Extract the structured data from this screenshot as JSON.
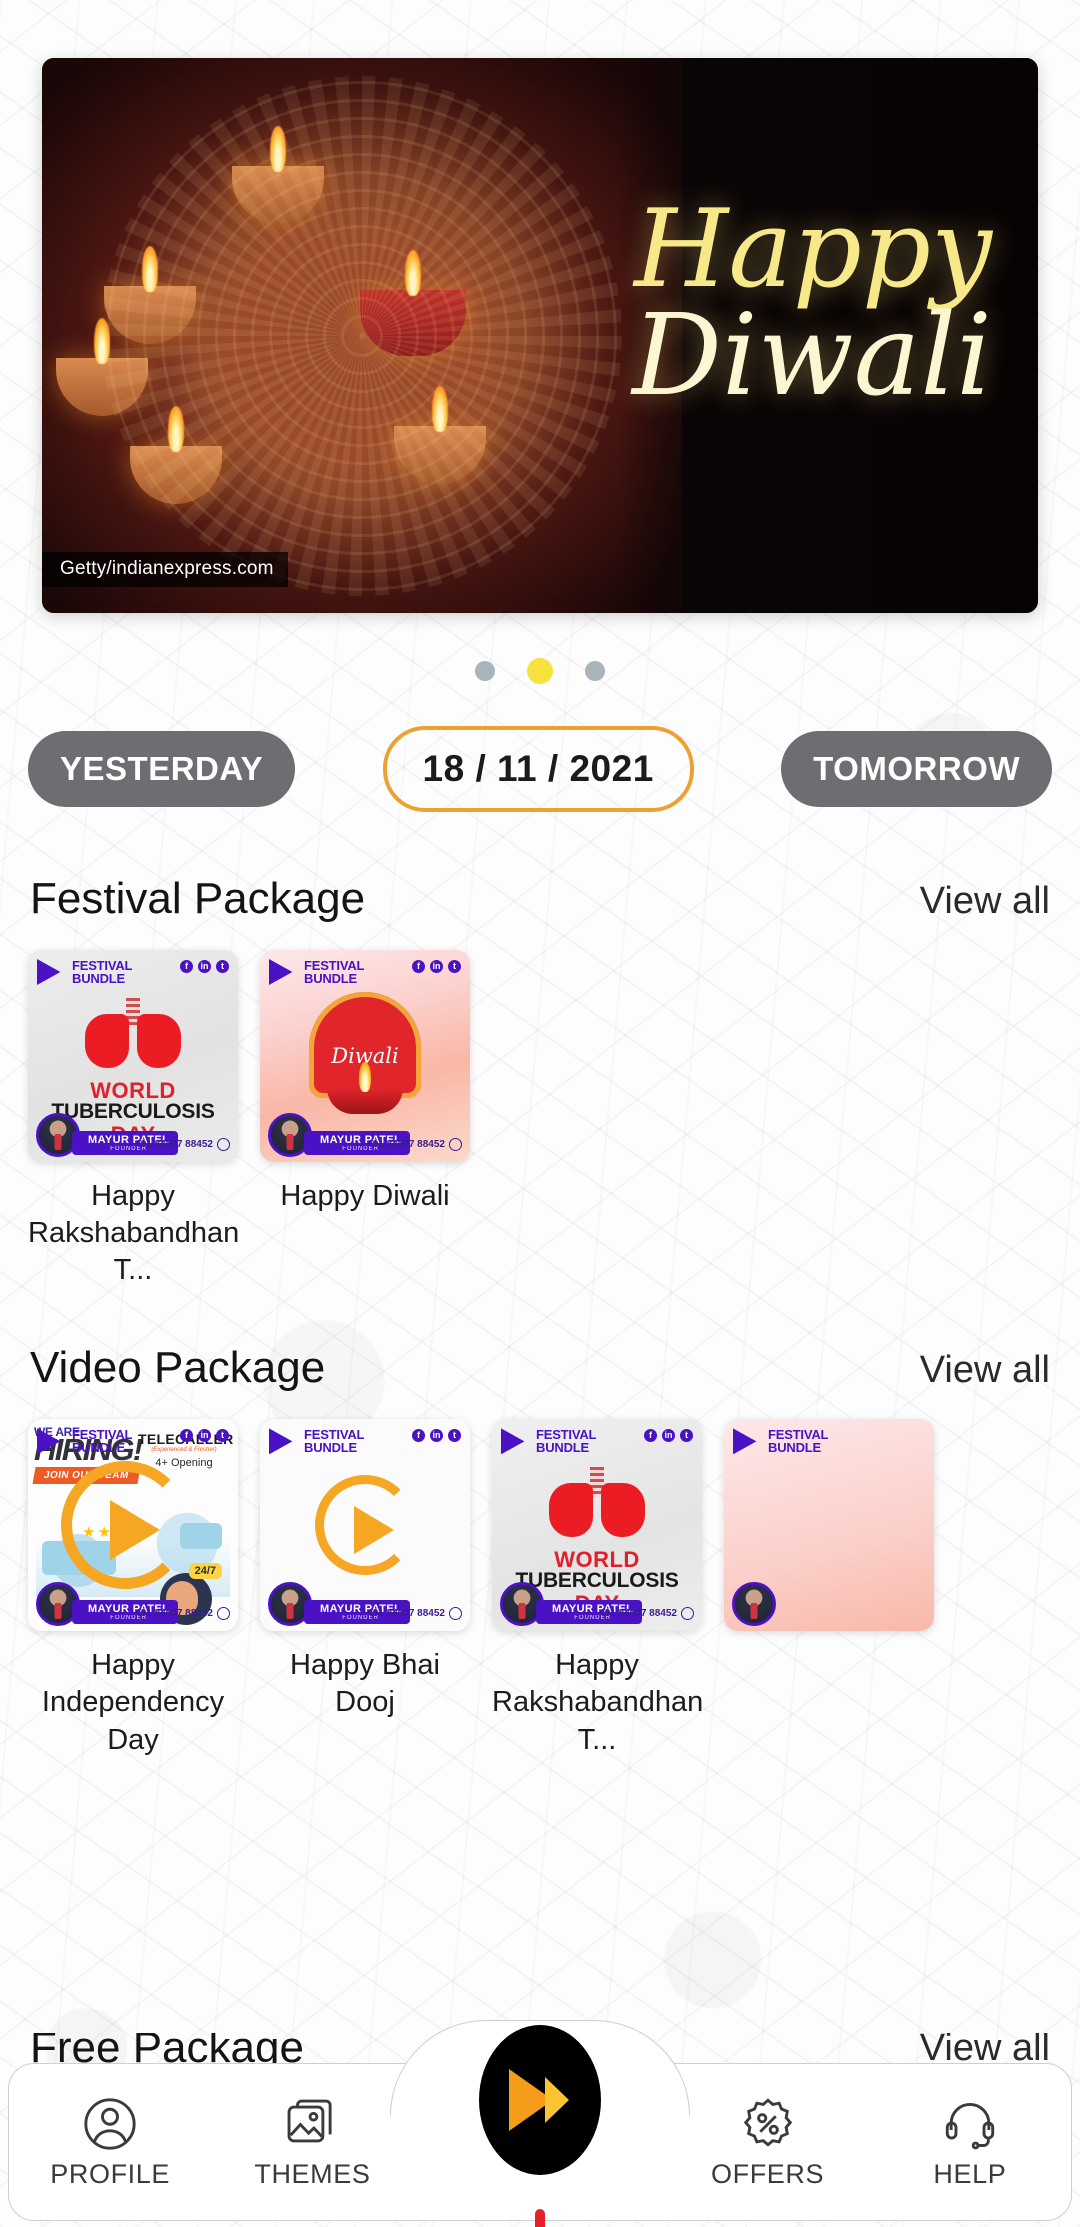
{
  "banner": {
    "title_line1": "Happy",
    "title_line2": "Diwali",
    "credit": "Getty/indianexpress.com"
  },
  "carousel": {
    "dots": [
      "inactive",
      "active",
      "inactive"
    ],
    "active_color": "#f7e23f",
    "inactive_color": "#a7b4bb"
  },
  "date_selector": {
    "yesterday_label": "YESTERDAY",
    "current_date": "18 / 11 / 2021",
    "tomorrow_label": "TOMORROW",
    "accent_color": "#eda033"
  },
  "sections": [
    {
      "title": "Festival Package",
      "view_all": "View all"
    },
    {
      "title": "Video Package",
      "view_all": "View all"
    },
    {
      "title": "Free Package",
      "view_all": "View all"
    }
  ],
  "card_chrome": {
    "brand_line1": "FESTIVAL",
    "brand_line2": "BUNDLE",
    "socials": [
      "f",
      "in",
      "t"
    ],
    "owner_name": "MAYUR PATEL",
    "owner_role": "FOUNDER",
    "phone": "+91 84607 88452"
  },
  "festival_package": {
    "cards": [
      {
        "caption": "Happy Rakshabandhan T...",
        "art": "world-tuberculosis-day",
        "art_text": {
          "line1": "WORLD",
          "line2": "TUBERCULOSIS",
          "line3": "DAY"
        }
      },
      {
        "caption": "Happy Diwali",
        "art": "diwali-arch",
        "art_text": {
          "line1": "Diwali"
        }
      }
    ]
  },
  "video_package": {
    "cards": [
      {
        "caption": "Happy Independency Day",
        "art": "we-are-hiring",
        "art_text": {
          "we": "WE ARE",
          "big": "HIRING!",
          "join": "JOIN OUR TEAM",
          "role": "TELECALLER",
          "role_sub": "(Experienced & Fresher)",
          "openings": "4+ Opening",
          "badge": "24/7"
        }
      },
      {
        "caption": "Happy Bhai Dooj",
        "art": "plain-play"
      },
      {
        "caption": "Happy Rakshabandhan T...",
        "art": "world-tuberculosis-day",
        "art_text": {
          "line1": "WORLD",
          "line2": "TUBERCULOSIS",
          "line3": "DAY"
        }
      },
      {
        "caption": "",
        "art": "pink-fade"
      }
    ]
  },
  "bottom_nav": {
    "items": [
      {
        "label": "PROFILE",
        "icon": "person-icon"
      },
      {
        "label": "THEMES",
        "icon": "image-gallery-icon"
      },
      {
        "label": "OFFERS",
        "icon": "percent-badge-icon"
      },
      {
        "label": "HELP",
        "icon": "headset-icon"
      }
    ],
    "fab": {
      "icon": "play-logo-icon",
      "background": "#000000",
      "accent": "#f59c1a"
    }
  }
}
